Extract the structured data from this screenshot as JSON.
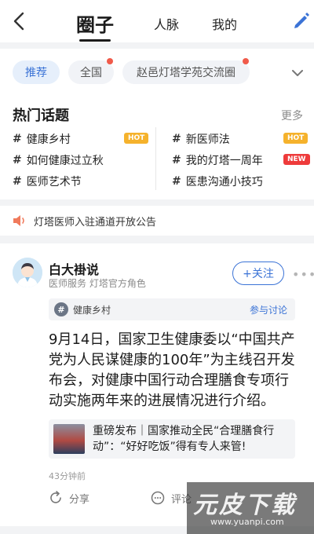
{
  "header": {
    "tab_main": "圈子",
    "tab_renmai": "人脉",
    "tab_mine": "我的"
  },
  "filters": {
    "chips": [
      {
        "label": "推荐",
        "active": true,
        "dot": false
      },
      {
        "label": "全国",
        "active": false,
        "dot": true
      },
      {
        "label": "赵邑灯塔学苑交流圈",
        "active": false,
        "dot": true
      }
    ]
  },
  "hot_topics": {
    "title": "热门话题",
    "more": "更多",
    "items": [
      {
        "label": "健康乡村",
        "badge": "HOT"
      },
      {
        "label": "如何健康过立秋",
        "badge": ""
      },
      {
        "label": "医师艺术节",
        "badge": ""
      },
      {
        "label": "新医师法",
        "badge": "HOT"
      },
      {
        "label": "我的灯塔一周年",
        "badge": "NEW"
      },
      {
        "label": "医患沟通小技巧",
        "badge": ""
      }
    ]
  },
  "notice": {
    "text": "灯塔医师入驻通道开放公告"
  },
  "post": {
    "author": "白大褂说",
    "author_sub": "医师服务 灯塔官方角色",
    "follow_label": "+关注",
    "topic": "健康乡村",
    "topic_join": "参与讨论",
    "body": "9月14日，国家卫生健康委以“中国共产党为人民谋健康的100年”为主线召开发布会，对健康中国行动合理膳食专项行动实施两年来的进展情况进行介绍。",
    "link_title": "重磅发布｜国家推动全民“合理膳食行动”：“好好吃饭”得有专人来管!",
    "time": "43分钟前",
    "share_label": "分享",
    "comment_label": "评论"
  },
  "watermark": {
    "big": "元皮下载",
    "url": "www.yuanpi.com"
  },
  "colors": {
    "accent": "#3b73d6",
    "hot": "#f5b22c",
    "new": "#ee3b3b",
    "dot": "#f05a4a"
  }
}
